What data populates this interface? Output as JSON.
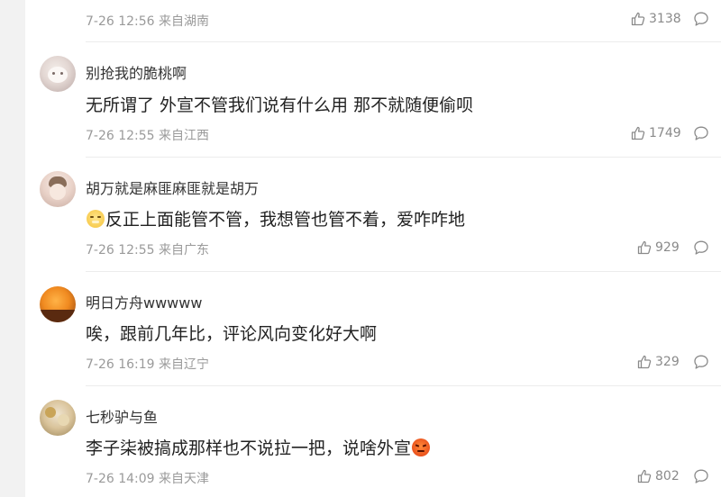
{
  "top_comment": {
    "time": "7-26 12:56",
    "location": "来自湖南",
    "likes": "3138"
  },
  "comments": [
    {
      "username": "别抢我的脆桃啊",
      "text": "无所谓了 外宣不管我们说有什么用 那不就随便偷呗",
      "time": "7-26 12:55",
      "location": "来自江西",
      "likes": "1749"
    },
    {
      "username": "胡万就是麻匪麻匪就是胡万",
      "text": "反正上面能管不管，我想管也管不着，爱咋咋地",
      "time": "7-26 12:55",
      "location": "来自广东",
      "likes": "929",
      "lead_emoji": "doge-face-icon"
    },
    {
      "username": "明日方舟wwwww",
      "text": "唉，跟前几年比，评论风向变化好大啊",
      "time": "7-26 16:19",
      "location": "来自辽宁",
      "likes": "329"
    },
    {
      "username": "七秒驴与鱼",
      "text": "李子柒被搞成那样也不说拉一把，说啥外宣",
      "time": "7-26 14:09",
      "location": "来自天津",
      "likes": "802",
      "trail_emoji": "angry-face-icon"
    }
  ],
  "colors": {
    "accent_text": "#333333",
    "meta_text": "#9a9a9a",
    "background": "#ffffff",
    "page_bg": "#f2f2f2"
  }
}
